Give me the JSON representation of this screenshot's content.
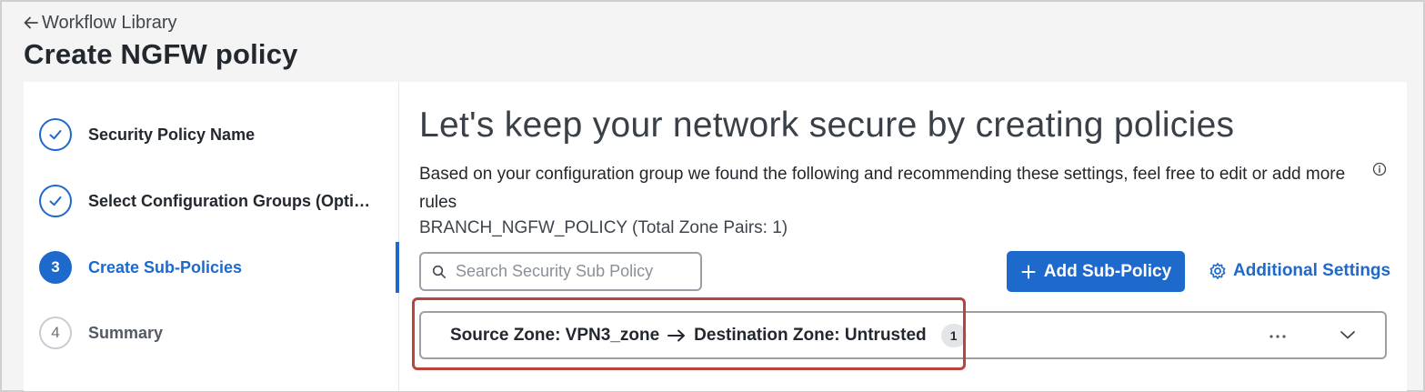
{
  "header": {
    "back_label": "Workflow Library",
    "title": "Create NGFW policy"
  },
  "steps": [
    {
      "label": "Security Policy Name",
      "status": "complete",
      "number": ""
    },
    {
      "label": "Select Configuration Groups (Optional)",
      "status": "complete",
      "number": ""
    },
    {
      "label": "Create Sub-Policies",
      "status": "active",
      "number": "3"
    },
    {
      "label": "Summary",
      "status": "todo",
      "number": "4"
    }
  ],
  "main": {
    "heading": "Let's keep your network secure by creating policies",
    "description": "Based on your configuration group we found the following and recommending these settings, feel free to edit or add more rules",
    "policy_name": "BRANCH_NGFW_POLICY (Total Zone Pairs: 1)",
    "search": {
      "placeholder": "Search Security Sub Policy",
      "value": ""
    },
    "add_button_label": "Add Sub-Policy",
    "settings_label": "Additional Settings"
  },
  "zone_pair": {
    "source": "Source Zone: VPN3_zone",
    "destination": "Destination Zone: Untrusted",
    "count": "1"
  },
  "colors": {
    "accent": "#1d69cc",
    "highlight": "#b8443b"
  }
}
